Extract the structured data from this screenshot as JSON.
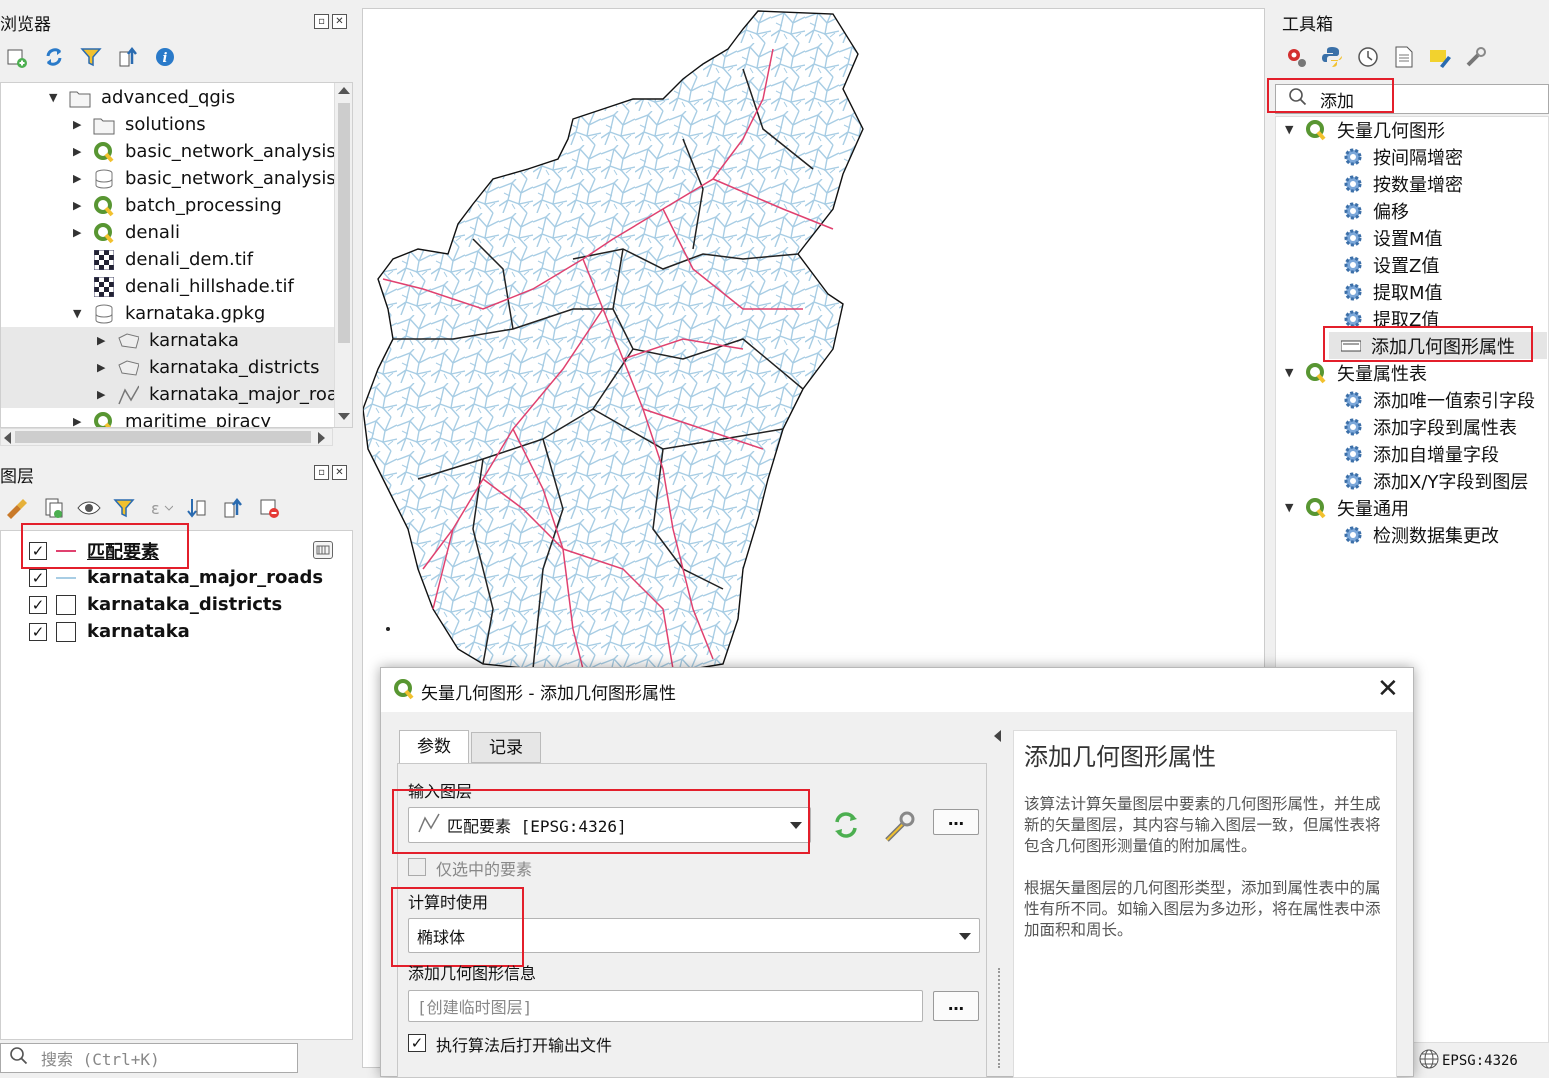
{
  "browser": {
    "title": "浏览器",
    "items": [
      {
        "label": "advanced_qgis",
        "icon": "folder-icon"
      },
      {
        "label": "solutions",
        "icon": "folder-icon"
      },
      {
        "label": "basic_network_analysis",
        "icon": "qgis-project-icon"
      },
      {
        "label": "basic_network_analysis.g",
        "icon": "geopackage-icon"
      },
      {
        "label": "batch_processing",
        "icon": "qgis-project-icon"
      },
      {
        "label": "denali",
        "icon": "qgis-project-icon"
      },
      {
        "label": "denali_dem.tif",
        "icon": "raster-icon"
      },
      {
        "label": "denali_hillshade.tif",
        "icon": "raster-icon"
      },
      {
        "label": "karnataka.gpkg",
        "icon": "geopackage-icon"
      },
      {
        "label": "karnataka",
        "icon": "polygon-layer-icon"
      },
      {
        "label": "karnataka_districts",
        "icon": "polygon-layer-icon"
      },
      {
        "label": "karnataka_major_roads",
        "icon": "line-layer-icon"
      },
      {
        "label": "maritime_piracy",
        "icon": "qgis-project-icon"
      }
    ]
  },
  "layers": {
    "title": "图层",
    "items": [
      {
        "label": "匹配要素",
        "checked": true,
        "symbol": "line",
        "color": "#e0416f"
      },
      {
        "label": "karnataka_major_roads",
        "checked": true,
        "symbol": "line",
        "color": "#a8cde4"
      },
      {
        "label": "karnataka_districts",
        "checked": true,
        "symbol": "polygon",
        "color": "#ffffff"
      },
      {
        "label": "karnataka",
        "checked": true,
        "symbol": "polygon",
        "color": "#ffffff"
      }
    ]
  },
  "search": {
    "placeholder": "搜索 (Ctrl+K)"
  },
  "toolbox": {
    "title": "工具箱",
    "search_value": "添加",
    "groups": [
      {
        "label": "矢量几何图形",
        "tools": [
          "按间隔增密",
          "按数量增密",
          "偏移",
          "设置M值",
          "设置Z值",
          "提取M值",
          "提取Z值",
          "添加几何图形属性"
        ]
      },
      {
        "label": "矢量属性表",
        "tools": [
          "添加唯一值索引字段",
          "添加字段到属性表",
          "添加自增量字段",
          "添加X/Y字段到图层"
        ]
      },
      {
        "label": "矢量通用",
        "tools": [
          "检测数据集更改"
        ]
      }
    ]
  },
  "status": {
    "crs": "EPSG:4326"
  },
  "dialog": {
    "title": "矢量几何图形 - 添加几何图形属性",
    "tabs": [
      "参数",
      "记录"
    ],
    "input_layer_label": "输入图层",
    "input_layer_value": "匹配要素 [EPSG:4326]",
    "selected_only_label": "仅选中的要素",
    "calc_label": "计算时使用",
    "calc_value": "椭球体",
    "output_label": "添加几何图形信息",
    "output_placeholder": "[创建临时图层]",
    "open_output_label": "执行算法后打开输出文件",
    "dots": "…",
    "help_title": "添加几何图形属性",
    "help_p1": "该算法计算矢量图层中要素的几何图形属性，并生成新的矢量图层，其内容与输入图层一致，但属性表将包含几何图形测量值的附加属性。",
    "help_p2": "根据矢量图层的几何图形类型，添加到属性表中的属性有所不同。如输入图层为多边形，将在属性表中添加面积和周长。"
  },
  "colors": {
    "highlight": "#e31f2b",
    "roads": "#a8cde4",
    "matched": "#e0416f",
    "qgis_green": "#589632"
  }
}
